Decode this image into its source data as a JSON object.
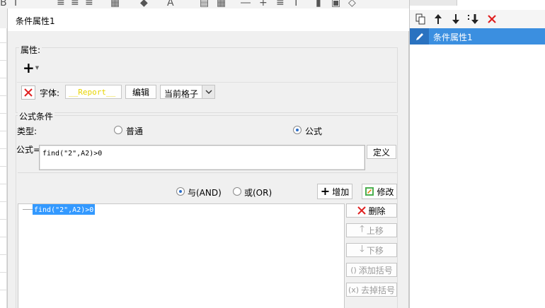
{
  "dialog": {
    "title": "条件属性1"
  },
  "properties": {
    "group_label": "属性:",
    "add_symbol": "+",
    "font_label": "字体:",
    "font_preview": "__Report__",
    "edit_button": "编辑",
    "scope_value": "当前格子"
  },
  "formula_condition": {
    "group_label": "公式条件",
    "type_label": "类型:",
    "type_normal": "普通",
    "type_formula": "公式",
    "formula_label": "公式=",
    "formula_value": "find(\"2\",A2)>0",
    "define_button": "定义",
    "and_label": "与(AND)",
    "or_label": "或(OR)",
    "add_button": "增加",
    "modify_button": "修改",
    "condition_items": [
      "find(\"2\",A2)>0"
    ],
    "delete_button": "删除",
    "move_up_button": "上移",
    "move_down_button": "下移",
    "add_bracket_button": "添加括号",
    "remove_bracket_button": "去掉括号"
  },
  "right_panel": {
    "selected_item": "条件属性1"
  },
  "colors": {
    "accent": "#3b8fe0",
    "delete_red": "#e02020",
    "font_preview_yellow": "#e8d400",
    "selection_blue": "#3399ff"
  }
}
